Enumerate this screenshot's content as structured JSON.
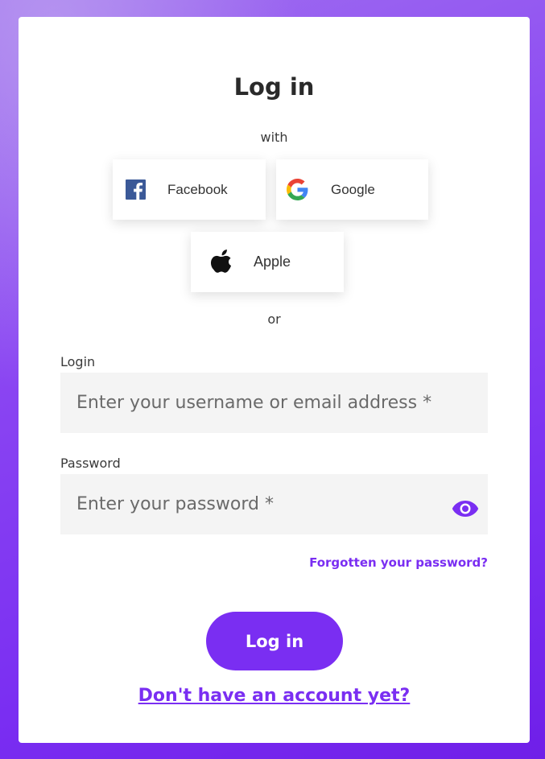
{
  "page": {
    "title": "Log in",
    "with_text": "with",
    "or_text": "or"
  },
  "social_buttons": [
    {
      "label": "Facebook",
      "icon": "facebook-icon"
    },
    {
      "label": "Google",
      "icon": "google-icon"
    },
    {
      "label": "Apple",
      "icon": "apple-icon"
    }
  ],
  "form": {
    "login_label": "Login",
    "login_placeholder": "Enter your username or email address *",
    "login_value": "",
    "password_label": "Password",
    "password_placeholder": "Enter your password *",
    "password_value": "",
    "show_password_icon": "eye-icon",
    "forgot_password": "Forgotten your password?",
    "submit_label": "Log in",
    "signup_link": "Don't have an account yet?"
  },
  "colors": {
    "accent": "#7a2ef2",
    "input_background": "#f4f4f4",
    "facebook_blue": "#3b5998"
  }
}
